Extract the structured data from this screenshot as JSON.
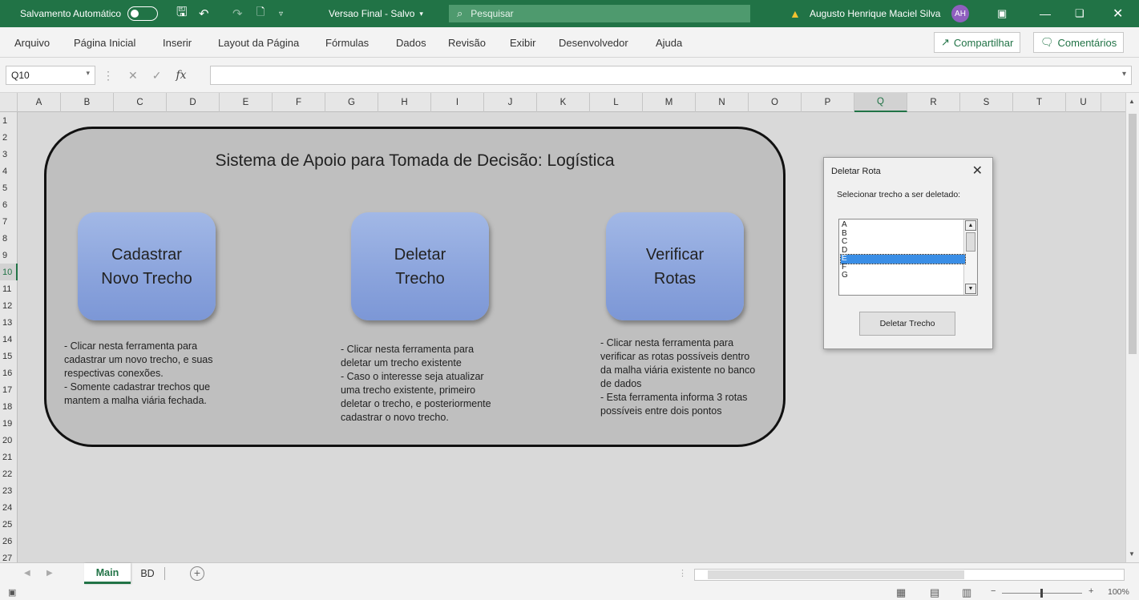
{
  "titlebar": {
    "autosave_label": "Salvamento Automático",
    "doc_title": "Versao Final - Salvo",
    "search_placeholder": "Pesquisar",
    "user_name": "Augusto Henrique Maciel Silva",
    "user_initials": "AH"
  },
  "menu": {
    "items": [
      "Arquivo",
      "Página Inicial",
      "Inserir",
      "Layout da Página",
      "Fórmulas",
      "Dados",
      "Revisão",
      "Exibir",
      "Desenvolvedor",
      "Ajuda"
    ],
    "share_label": "Compartilhar",
    "comments_label": "Comentários"
  },
  "formula_bar": {
    "name_box": "Q10",
    "fx_label": "fx",
    "formula_value": ""
  },
  "grid": {
    "columns": [
      "A",
      "B",
      "C",
      "D",
      "E",
      "F",
      "G",
      "H",
      "I",
      "J",
      "K",
      "L",
      "M",
      "N",
      "O",
      "P",
      "Q",
      "R",
      "S",
      "T",
      "U"
    ],
    "rows": [
      "1",
      "2",
      "3",
      "4",
      "5",
      "6",
      "7",
      "8",
      "9",
      "10",
      "11",
      "12",
      "13",
      "14",
      "15",
      "16",
      "17",
      "18",
      "19",
      "20",
      "21",
      "22",
      "23",
      "24",
      "25",
      "26",
      "27"
    ],
    "selected_column": "Q",
    "selected_row": "10"
  },
  "panel": {
    "title": "Sistema de Apoio para Tomada de Decisão: Logística",
    "tools": [
      {
        "label_line1": "Cadastrar",
        "label_line2": "Novo Trecho",
        "description": "- Clicar nesta ferramenta para\ncadastrar um novo trecho, e suas\nrespectivas conexões.\n- Somente cadastrar trechos que\nmantem a malha viária fechada."
      },
      {
        "label_line1": "Deletar",
        "label_line2": "Trecho",
        "description": "- Clicar nesta ferramenta para\ndeletar um trecho existente\n- Caso o interesse seja atualizar\numa trecho existente, primeiro\ndeletar o trecho, e posteriormente\ncadastrar o novo trecho."
      },
      {
        "label_line1": "Verificar",
        "label_line2": "Rotas",
        "description": "- Clicar nesta ferramenta para\nverificar as rotas possíveis dentro\nda malha viária existente no banco\nde dados\n- Esta ferramenta informa 3 rotas\npossíveis entre dois pontos"
      }
    ]
  },
  "dialog": {
    "title": "Deletar Rota",
    "label": "Selecionar trecho a ser deletado:",
    "options": [
      "A",
      "B",
      "C",
      "D",
      "E",
      "F",
      "G"
    ],
    "selected_option": "E",
    "button_label": "Deletar Trecho"
  },
  "sheets": {
    "tabs": [
      "Main",
      "BD"
    ],
    "active": "Main"
  },
  "status": {
    "zoom": "100%"
  },
  "colors": {
    "accent": "#217346",
    "panel_bg": "#bfbfbf",
    "button_blue": "#8aa3dc",
    "selection_blue": "#3a8ee6"
  }
}
